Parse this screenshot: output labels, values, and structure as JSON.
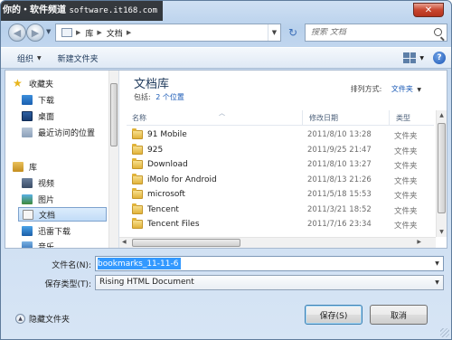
{
  "watermark": {
    "brand": "你的・软件频道",
    "url": "software.it168.com"
  },
  "window": {
    "close_glyph": "✕"
  },
  "nav": {
    "breadcrumbs": [
      "库",
      "文档"
    ],
    "search_placeholder": "搜索 文档"
  },
  "toolbar": {
    "organize": "组织",
    "new_folder": "新建文件夹",
    "help": "?"
  },
  "sidebar": {
    "favorites_label": "收藏夹",
    "favorites": [
      "下载",
      "桌面",
      "最近访问的位置"
    ],
    "libraries_label": "库",
    "libraries": [
      "视频",
      "图片",
      "文档",
      "迅雷下载",
      "音乐"
    ],
    "selected": "文档"
  },
  "content": {
    "title": "文档库",
    "includes_label": "包括:",
    "includes_link": "2 个位置",
    "arrange_label": "排列方式:",
    "arrange_value": "文件夹",
    "columns": {
      "name": "名称",
      "modified": "修改日期",
      "type": "类型"
    },
    "files": [
      {
        "name": "91 Mobile",
        "date": "2011/8/10 13:28",
        "type": "文件夹"
      },
      {
        "name": "925",
        "date": "2011/9/25 21:47",
        "type": "文件夹"
      },
      {
        "name": "Download",
        "date": "2011/8/10 13:27",
        "type": "文件夹"
      },
      {
        "name": "iMolo for Android",
        "date": "2011/8/13 21:26",
        "type": "文件夹"
      },
      {
        "name": "microsoft",
        "date": "2011/5/18 15:53",
        "type": "文件夹"
      },
      {
        "name": "Tencent",
        "date": "2011/3/21 18:52",
        "type": "文件夹"
      },
      {
        "name": "Tencent Files",
        "date": "2011/7/16 23:34",
        "type": "文件夹"
      }
    ]
  },
  "form": {
    "filename_label": "文件名(N):",
    "filename_value": "bookmarks_11-11-6",
    "filetype_label": "保存类型(T):",
    "filetype_value": "Rising HTML Document"
  },
  "footer": {
    "hide_folders": "隐藏文件夹",
    "save": "保存(S)",
    "cancel": "取消"
  },
  "colors": {
    "accent": "#1a5ab6",
    "selection": "#3399ff",
    "titlebar": "#b9d1ec"
  }
}
